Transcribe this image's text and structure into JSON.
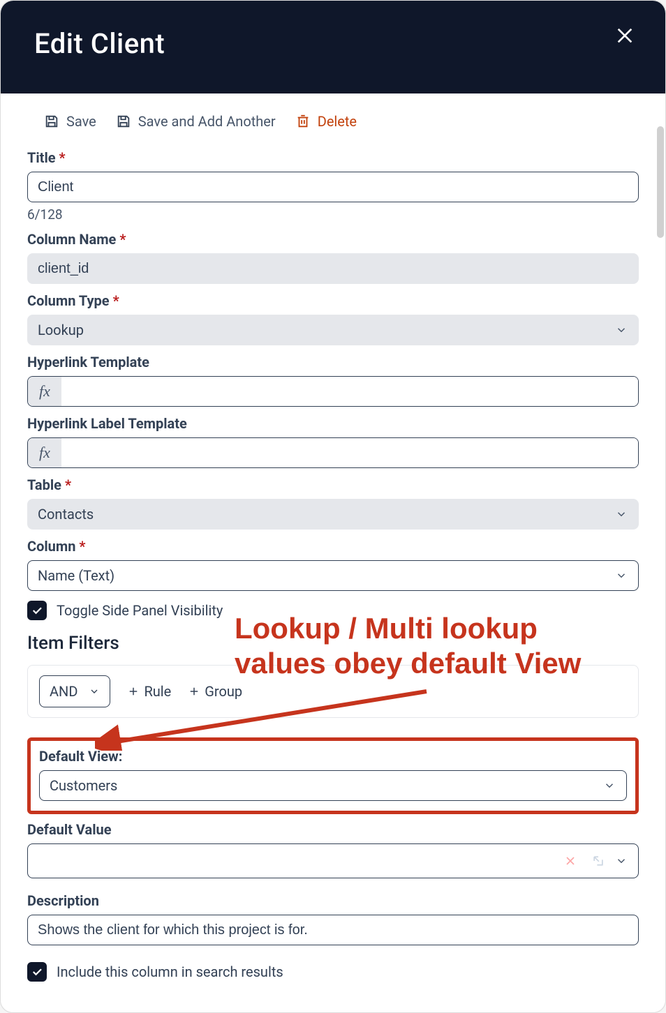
{
  "header": {
    "title": "Edit Client"
  },
  "toolbar": {
    "save_label": "Save",
    "save_add_label": "Save and Add Another",
    "delete_label": "Delete"
  },
  "fields": {
    "title_label": "Title",
    "title_value": "Client",
    "title_count": "6/128",
    "colname_label": "Column Name",
    "colname_value": "client_id",
    "coltype_label": "Column Type",
    "coltype_value": "Lookup",
    "hl_template_label": "Hyperlink Template",
    "hl_label_template_label": "Hyperlink Label Template",
    "fx_symbol": "fx",
    "table_label": "Table",
    "table_value": "Contacts",
    "column_label": "Column",
    "column_value": "Name (Text)",
    "toggle_side_panel_label": "Toggle Side Panel Visibility",
    "item_filters_heading": "Item Filters",
    "filter_operator": "AND",
    "filter_rule_label": "Rule",
    "filter_group_label": "Group",
    "default_view_label": "Default View:",
    "default_view_value": "Customers",
    "default_value_label": "Default Value",
    "description_label": "Description",
    "description_value": "Shows the client for which this project is for.",
    "include_search_label": "Include this column in search results"
  },
  "annotation": {
    "line1": "Lookup / Multi lookup",
    "line2": "values obey default View"
  }
}
